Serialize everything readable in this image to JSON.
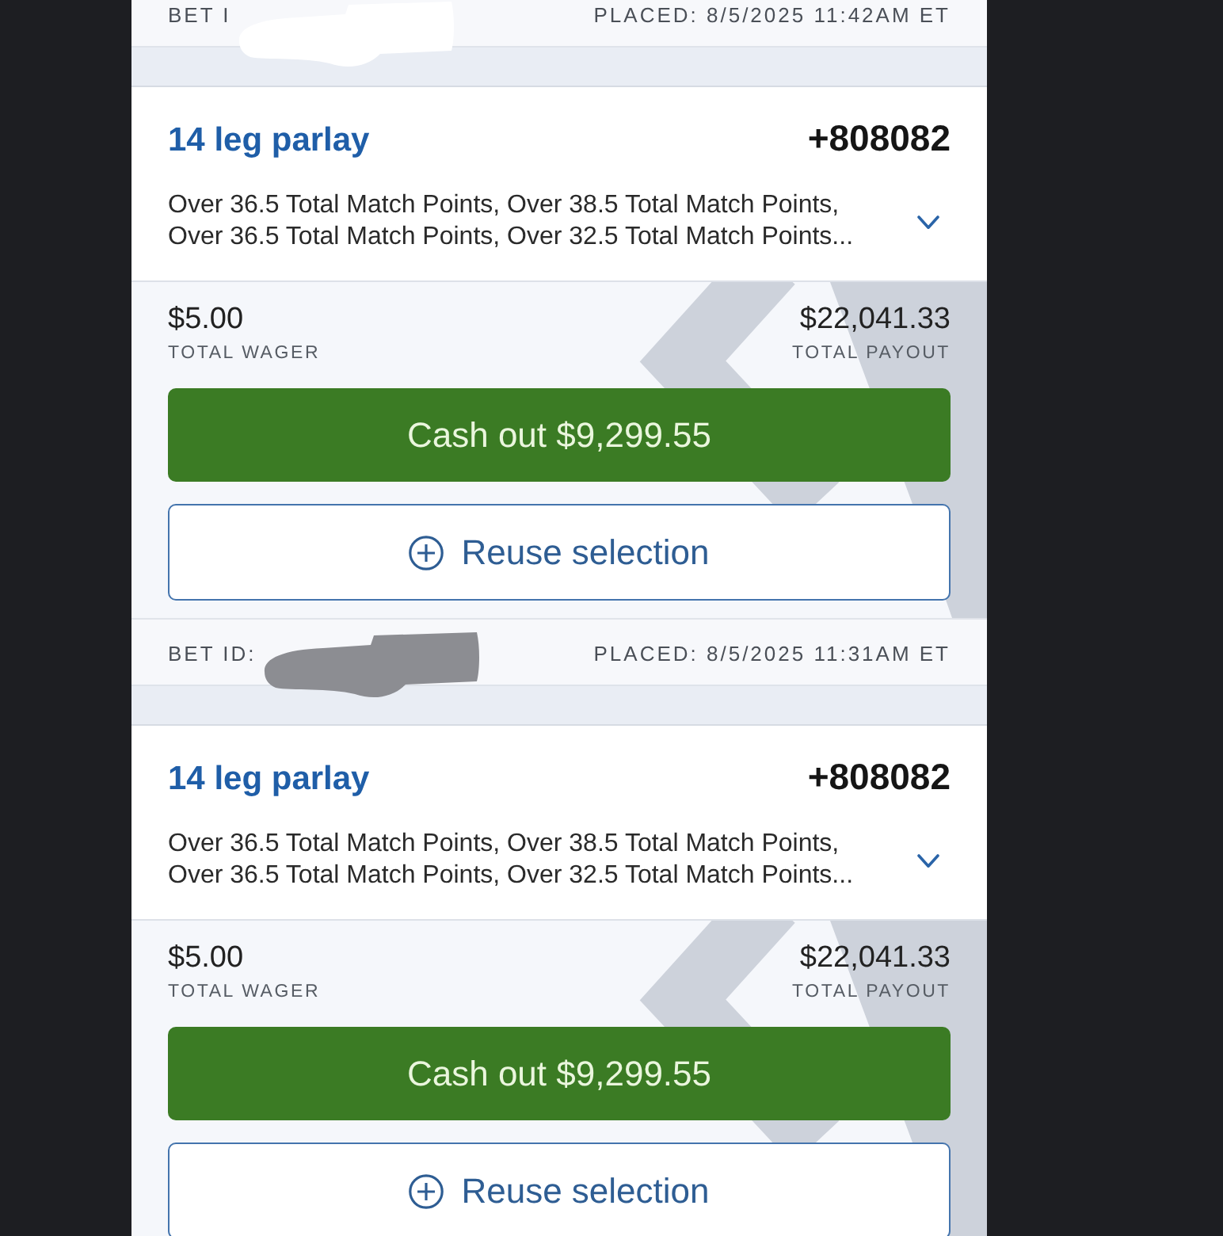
{
  "bets": [
    {
      "footer": {
        "bet_id_label": "BET I",
        "redaction": {
          "color": "#ffffff"
        },
        "placed": "PLACED: 8/5/2025 11:42AM ET"
      }
    },
    {
      "title": "14 leg parlay",
      "odds": "+808082",
      "legs": "Over 36.5 Total Match Points, Over 38.5 Total Match Points, Over 36.5 Total Match Points, Over 32.5 Total Match Points...",
      "expanded": false,
      "total_wager": {
        "amount": "$5.00",
        "label": "TOTAL WAGER"
      },
      "total_payout": {
        "amount": "$22,041.33",
        "label": "TOTAL PAYOUT"
      },
      "cash_out_button": "Cash out $9,299.55",
      "reuse_button": "Reuse selection",
      "footer": {
        "bet_id_label": "BET ID:",
        "redaction": {
          "color": "#8c8d92"
        },
        "placed": "PLACED: 8/5/2025 11:31AM ET"
      }
    },
    {
      "title": "14 leg parlay",
      "odds": "+808082",
      "legs": "Over 36.5 Total Match Points, Over 38.5 Total Match Points, Over 36.5 Total Match Points, Over 32.5 Total Match Points...",
      "expanded": false,
      "total_wager": {
        "amount": "$5.00",
        "label": "TOTAL WAGER"
      },
      "total_payout": {
        "amount": "$22,041.33",
        "label": "TOTAL PAYOUT"
      },
      "cash_out_button": "Cash out $9,299.55",
      "reuse_button": "Reuse selection"
    }
  ]
}
